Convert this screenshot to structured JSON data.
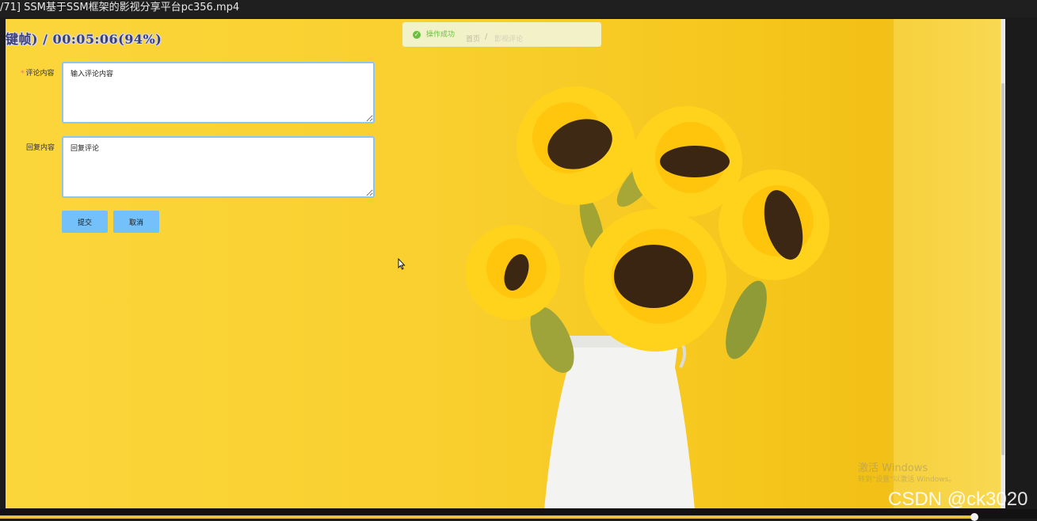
{
  "window": {
    "title": "/71] SSM基于SSM框架的影视分享平台pc356.mp4"
  },
  "player": {
    "timecode": "键帧) / 00:05:06(94%)",
    "progress_percent": 94
  },
  "toast": {
    "message": "操作成功",
    "icon": "success-check-icon"
  },
  "breadcrumb": {
    "home": "首页",
    "separator": "/",
    "current": "影视评论"
  },
  "form": {
    "comment_label": "评论内容",
    "comment_required": "*",
    "comment_value": "输入评论内容",
    "reply_label": "回复内容",
    "reply_value": "回复评论",
    "submit_label": "提交",
    "cancel_label": "取消"
  },
  "watermarks": {
    "windows_line1": "激活 Windows",
    "windows_line2": "转到\"设置\"以激活 Windows。",
    "csdn": "CSDN @ck3020"
  },
  "colors": {
    "background_yellow": "#f9cf2e",
    "button_blue": "#73c0fb",
    "input_border": "#8ec5ef",
    "success_green": "#67c23a",
    "required_red": "#f56c6c"
  }
}
